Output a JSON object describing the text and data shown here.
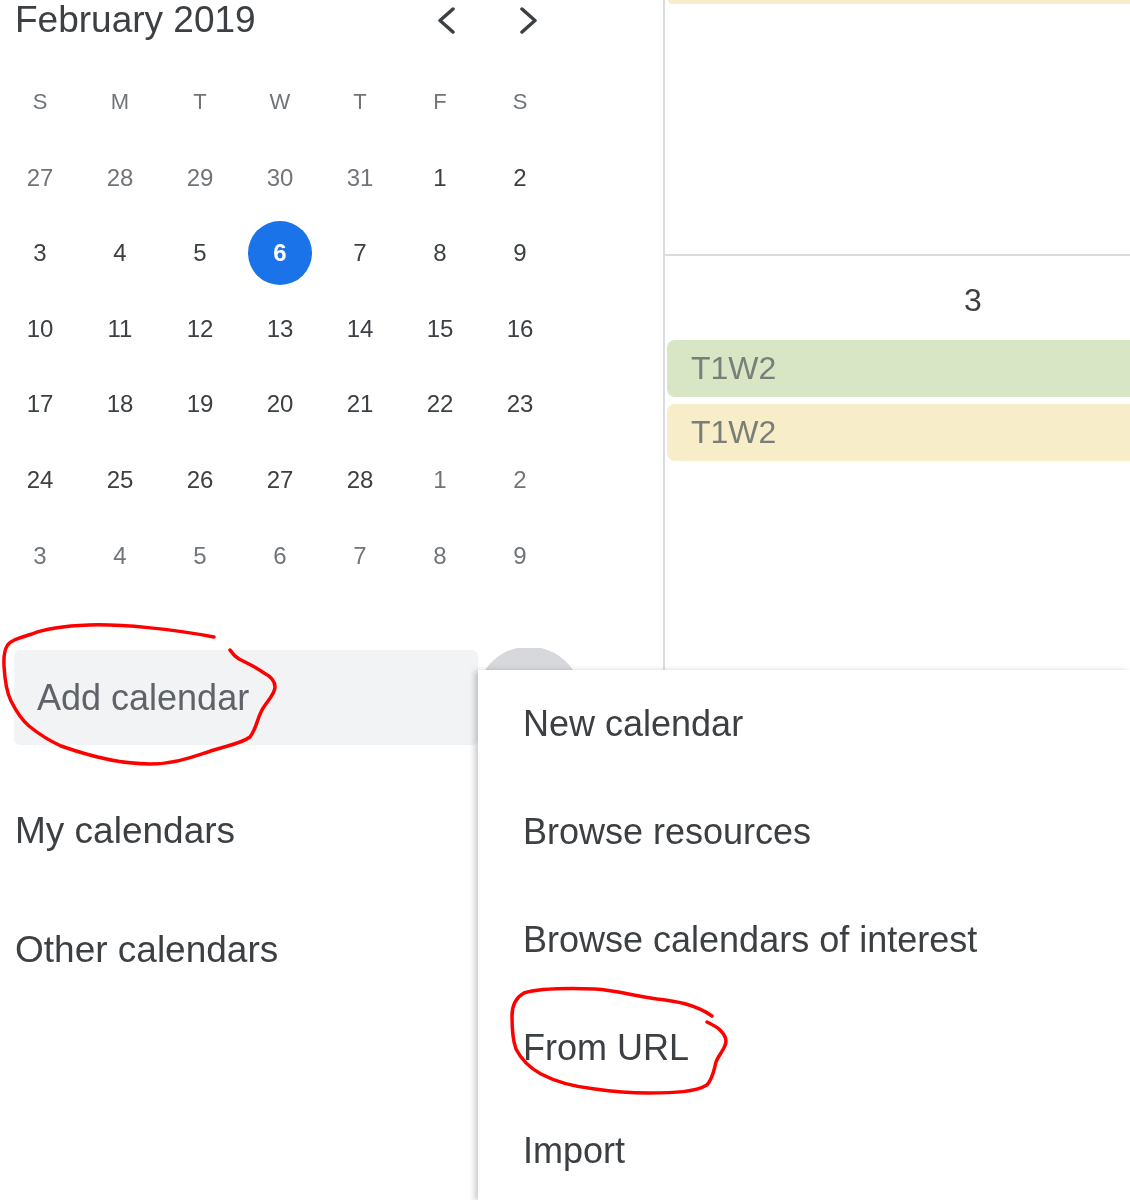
{
  "mini_calendar": {
    "title": "February 2019",
    "weekdays": [
      "S",
      "M",
      "T",
      "W",
      "T",
      "F",
      "S"
    ],
    "weeks": [
      [
        {
          "day": "27",
          "in_month": false,
          "selected": false
        },
        {
          "day": "28",
          "in_month": false,
          "selected": false
        },
        {
          "day": "29",
          "in_month": false,
          "selected": false
        },
        {
          "day": "30",
          "in_month": false,
          "selected": false
        },
        {
          "day": "31",
          "in_month": false,
          "selected": false
        },
        {
          "day": "1",
          "in_month": true,
          "selected": false
        },
        {
          "day": "2",
          "in_month": true,
          "selected": false
        }
      ],
      [
        {
          "day": "3",
          "in_month": true,
          "selected": false
        },
        {
          "day": "4",
          "in_month": true,
          "selected": false
        },
        {
          "day": "5",
          "in_month": true,
          "selected": false
        },
        {
          "day": "6",
          "in_month": true,
          "selected": true
        },
        {
          "day": "7",
          "in_month": true,
          "selected": false
        },
        {
          "day": "8",
          "in_month": true,
          "selected": false
        },
        {
          "day": "9",
          "in_month": true,
          "selected": false
        }
      ],
      [
        {
          "day": "10",
          "in_month": true,
          "selected": false
        },
        {
          "day": "11",
          "in_month": true,
          "selected": false
        },
        {
          "day": "12",
          "in_month": true,
          "selected": false
        },
        {
          "day": "13",
          "in_month": true,
          "selected": false
        },
        {
          "day": "14",
          "in_month": true,
          "selected": false
        },
        {
          "day": "15",
          "in_month": true,
          "selected": false
        },
        {
          "day": "16",
          "in_month": true,
          "selected": false
        }
      ],
      [
        {
          "day": "17",
          "in_month": true,
          "selected": false
        },
        {
          "day": "18",
          "in_month": true,
          "selected": false
        },
        {
          "day": "19",
          "in_month": true,
          "selected": false
        },
        {
          "day": "20",
          "in_month": true,
          "selected": false
        },
        {
          "day": "21",
          "in_month": true,
          "selected": false
        },
        {
          "day": "22",
          "in_month": true,
          "selected": false
        },
        {
          "day": "23",
          "in_month": true,
          "selected": false
        }
      ],
      [
        {
          "day": "24",
          "in_month": true,
          "selected": false
        },
        {
          "day": "25",
          "in_month": true,
          "selected": false
        },
        {
          "day": "26",
          "in_month": true,
          "selected": false
        },
        {
          "day": "27",
          "in_month": true,
          "selected": false
        },
        {
          "day": "28",
          "in_month": true,
          "selected": false
        },
        {
          "day": "1",
          "in_month": false,
          "selected": false
        },
        {
          "day": "2",
          "in_month": false,
          "selected": false
        }
      ],
      [
        {
          "day": "3",
          "in_month": false,
          "selected": false
        },
        {
          "day": "4",
          "in_month": false,
          "selected": false
        },
        {
          "day": "5",
          "in_month": false,
          "selected": false
        },
        {
          "day": "6",
          "in_month": false,
          "selected": false
        },
        {
          "day": "7",
          "in_month": false,
          "selected": false
        },
        {
          "day": "8",
          "in_month": false,
          "selected": false
        },
        {
          "day": "9",
          "in_month": false,
          "selected": false
        }
      ]
    ]
  },
  "add_calendar": {
    "placeholder": "Add calendar",
    "annotated": true
  },
  "sections": [
    {
      "title": "My calendars"
    },
    {
      "title": "Other calendars"
    }
  ],
  "month_grid": {
    "cells": [
      {
        "events": [
          {
            "color": "#f7edc8"
          }
        ]
      },
      {
        "day": "3",
        "events": [
          {
            "title": "T1W2",
            "color": "#d8e6c6"
          },
          {
            "title": "T1W2",
            "color": "#f7edc8"
          }
        ]
      }
    ]
  },
  "menu": {
    "items": [
      {
        "label": "New calendar",
        "annotated": false
      },
      {
        "label": "Browse resources",
        "annotated": false
      },
      {
        "label": "Browse calendars of interest",
        "annotated": false
      },
      {
        "label": "From URL",
        "annotated": true
      },
      {
        "label": "Import",
        "annotated": false
      }
    ]
  }
}
